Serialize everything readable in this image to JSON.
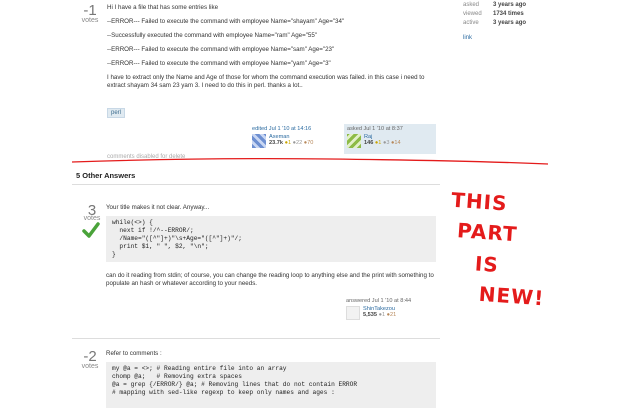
{
  "question": {
    "votes": "-1",
    "votes_label": "votes",
    "paragraphs": [
      "Hi I have a file that has some entries like",
      "--ERROR--- Failed to execute the command with employee Name=\"shayam\" Age=\"34\"",
      "--Successfully executed the command with employee Name=\"ram\" Age=\"55\"",
      "--ERROR--- Failed to execute the command with employee Name=\"sam\" Age=\"23\"",
      "--ERROR--- Failed to execute the command with employee Name=\"yam\" Age=\"3\"",
      "I have to extract only the Name and Age of those for whom the command execution was failed. in this case i need to extract shayam 34 sam 23 yam 3. I need to do this in perl. thanks a lot.."
    ],
    "tag": "perl",
    "edited": {
      "label": "edited Jul 1 '10 at 14:16",
      "user": "Axeman",
      "rep": "23.7k",
      "gold": "●1",
      "silver": "●22",
      "bronze": "●70"
    },
    "asked": {
      "label": "asked Jul 1 '10 at 8:37",
      "user": "Raj",
      "rep": "146",
      "gold": "●1",
      "silver": "●3",
      "bronze": "●14"
    },
    "comments_link": "comments disabled for delete"
  },
  "sidebar": {
    "rows": [
      {
        "label": "asked",
        "value": "3 years ago"
      },
      {
        "label": "viewed",
        "value": "1734 times"
      },
      {
        "label": "active",
        "value": "3 years ago"
      }
    ],
    "link": "link"
  },
  "answers_header": "5 Other Answers",
  "answer1": {
    "votes": "3",
    "votes_label": "votes",
    "intro": "Your title makes it not clear. Anyway...",
    "code": "while(<>) {\n  next if !/^--ERROR/;\n  /Name=\"([^\"]+)\"\\s+Age=\"([^\"]+)\"/;\n  print $1, \" \", $2, \"\\n\";\n}",
    "outro": "can do it reading from stdin; of course, you can change the reading loop to anything else and the print with something to populate an hash or whatever according to your needs.",
    "answered": {
      "label": "answered Jul 1 '10 at 8:44",
      "user": "ShinTakezou",
      "rep": "5,535",
      "silver": "●1",
      "bronze": "●21"
    }
  },
  "answer2": {
    "votes": "-2",
    "votes_label": "votes",
    "intro": "Refer to comments :",
    "code": "my @a = <>; # Reading entire file into an array\nchomp @a;   # Removing extra spaces\n@a = grep {/ERROR/} @a; # Removing lines that do not contain ERROR\n# mapping with sed-like regexp to keep only names and ages :"
  },
  "annotation": {
    "lines": [
      "THIS",
      "PART",
      "IS",
      "NEW!"
    ],
    "color": "#e41b1b"
  }
}
